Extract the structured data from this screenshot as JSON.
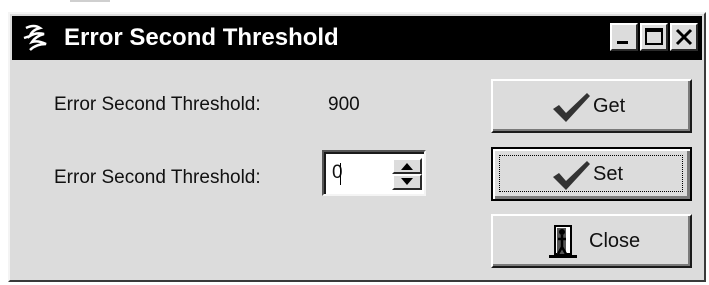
{
  "window": {
    "title": "Error Second Threshold",
    "title_icon": "app-icon",
    "controls": {
      "minimize_icon": "minimize-icon",
      "maximize_icon": "maximize-icon",
      "close_icon": "close-icon"
    }
  },
  "form": {
    "current_label": "Error Second Threshold:",
    "current_value": "900",
    "input_label": "Error Second Threshold:",
    "input_value": "0",
    "spin_up_icon": "spin-up-arrow-icon",
    "spin_down_icon": "spin-down-arrow-icon"
  },
  "buttons": {
    "get_label": "Get",
    "set_label": "Set",
    "close_label": "Close",
    "get_icon": "checkmark-icon",
    "set_icon": "checkmark-icon",
    "close_icon": "door-exit-icon"
  },
  "colors": {
    "titlebar_bg": "#000000",
    "titlebar_text": "#ffffff",
    "window_bg": "#dcdcdc"
  }
}
